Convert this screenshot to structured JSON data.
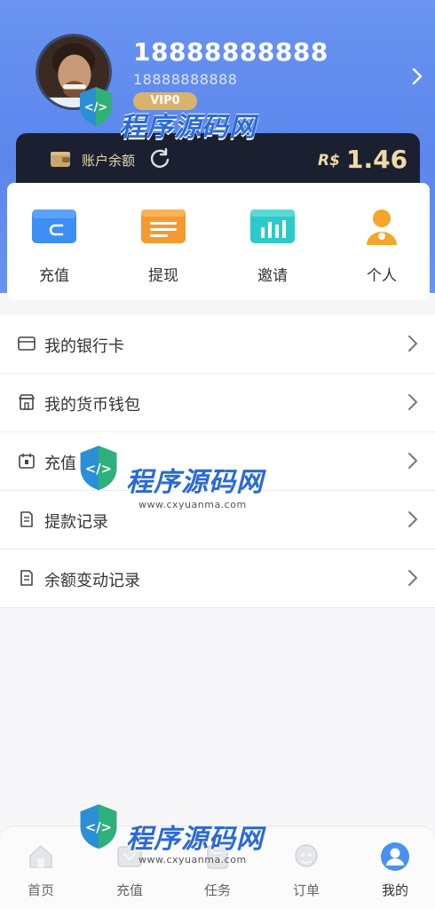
{
  "profile": {
    "phone_main": "18888888888",
    "phone_sub": "18888888888",
    "vip_level": "VIP0"
  },
  "balance": {
    "label": "账户余额",
    "currency": "R$",
    "amount": "1.46"
  },
  "quick_actions": [
    {
      "label": "充值",
      "icon": "recharge-card-icon",
      "color": "#3d8ef5"
    },
    {
      "label": "提现",
      "icon": "withdraw-icon",
      "color": "#f59a30"
    },
    {
      "label": "邀请",
      "icon": "invite-icon",
      "color": "#2ec9c9"
    },
    {
      "label": "个人",
      "icon": "person-icon",
      "color": "#f4a52a"
    }
  ],
  "menu": [
    {
      "label": "我的银行卡",
      "icon": "bank-card-icon"
    },
    {
      "label": "我的货币钱包",
      "icon": "store-wallet-icon"
    },
    {
      "label": "充值",
      "icon": "calendar-icon"
    },
    {
      "label": "提款记录",
      "icon": "document-icon"
    },
    {
      "label": "余额变动记录",
      "icon": "document-icon"
    }
  ],
  "tabbar": [
    {
      "label": "首页",
      "icon": "home-icon"
    },
    {
      "label": "充值",
      "icon": "recharge-icon"
    },
    {
      "label": "任务",
      "icon": "task-icon"
    },
    {
      "label": "订单",
      "icon": "order-icon"
    },
    {
      "label": "我的",
      "icon": "profile-icon",
      "active": true
    }
  ],
  "watermark": {
    "title": "程序源码网",
    "url": "www.cxyuanma.com"
  },
  "colors": {
    "header": "#5b86ec",
    "card_dark": "#1b2030",
    "gold": "#f0d9a6",
    "vip": "#d9b26f",
    "active_tab": "#4a90f0"
  }
}
